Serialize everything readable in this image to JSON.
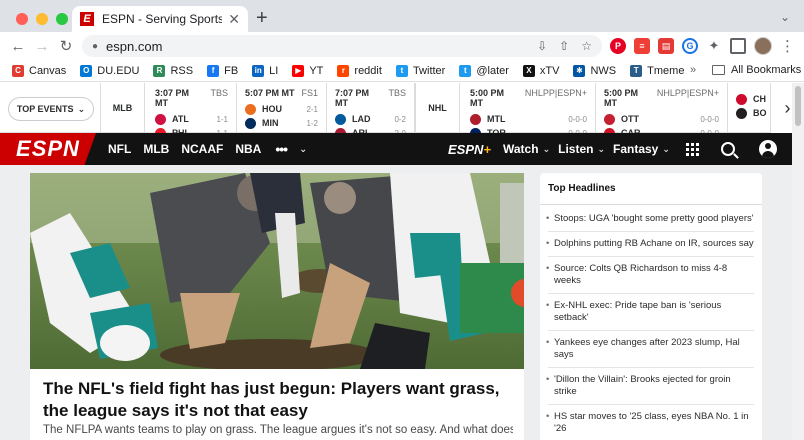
{
  "browser": {
    "tab_title": "ESPN - Serving Sports Fans. A",
    "tab_favicon": "E",
    "new_tab": "+",
    "url": "espn.com",
    "traffic_lights": [
      "#ff5f57",
      "#febc2e",
      "#28c840"
    ]
  },
  "bookmarks": {
    "items": [
      {
        "label": "Canvas",
        "color": "#e03c31",
        "glyph": "C"
      },
      {
        "label": "DU.EDU",
        "color": "#0078d4",
        "glyph": "O"
      },
      {
        "label": "RSS",
        "color": "#2e8b57",
        "glyph": "R"
      },
      {
        "label": "FB",
        "color": "#1877f2",
        "glyph": "f"
      },
      {
        "label": "LI",
        "color": "#0a66c2",
        "glyph": "in"
      },
      {
        "label": "YT",
        "color": "#ff0000",
        "glyph": "▶"
      },
      {
        "label": "reddit",
        "color": "#ff4500",
        "glyph": "r"
      },
      {
        "label": "Twitter",
        "color": "#1d9bf0",
        "glyph": "t"
      },
      {
        "label": "@later",
        "color": "#1d9bf0",
        "glyph": "t"
      },
      {
        "label": "xTV",
        "color": "#111111",
        "glyph": "X"
      },
      {
        "label": "NWS",
        "color": "#0057a8",
        "glyph": "✱"
      },
      {
        "label": "Tmeme",
        "color": "#2b5d8a",
        "glyph": "T"
      }
    ],
    "more": "»",
    "all_bookmarks": "All Bookmarks"
  },
  "scoreboard": {
    "top_events": "TOP EVENTS",
    "league_mlb": "MLB",
    "league_nhl": "NHL",
    "games": [
      {
        "time": "3:07 PM MT",
        "net": "TBS",
        "teams": [
          {
            "abbr": "ATL",
            "rec": "1-1",
            "color": "#ce1141"
          },
          {
            "abbr": "PHI",
            "rec": "1-1",
            "color": "#e81828"
          }
        ]
      },
      {
        "time": "5:07 PM MT",
        "net": "FS1",
        "teams": [
          {
            "abbr": "HOU",
            "rec": "2-1",
            "color": "#eb6e1f"
          },
          {
            "abbr": "MIN",
            "rec": "1-2",
            "color": "#002b5c"
          }
        ]
      },
      {
        "time": "7:07 PM MT",
        "net": "TBS",
        "teams": [
          {
            "abbr": "LAD",
            "rec": "0-2",
            "color": "#005a9c"
          },
          {
            "abbr": "ARI",
            "rec": "2-0",
            "color": "#a71930"
          }
        ]
      },
      {
        "time": "5:00 PM MT",
        "net": "NHLPP|ESPN+",
        "teams": [
          {
            "abbr": "MTL",
            "rec": "0-0-0",
            "color": "#af1e2d"
          },
          {
            "abbr": "TOR",
            "rec": "0-0-0",
            "color": "#00205b"
          }
        ]
      },
      {
        "time": "5:00 PM MT",
        "net": "NHLPP|ESPN+",
        "teams": [
          {
            "abbr": "OTT",
            "rec": "0-0-0",
            "color": "#c52032"
          },
          {
            "abbr": "CAR",
            "rec": "0-0-0",
            "color": "#ce1126"
          }
        ]
      },
      {
        "time": "",
        "net": "",
        "teams": [
          {
            "abbr": "CH",
            "rec": "",
            "color": "#cf0a2c"
          },
          {
            "abbr": "BO",
            "rec": "",
            "color": "#231f20"
          }
        ]
      }
    ]
  },
  "espn_nav": {
    "logo": "ESPN",
    "left": [
      "NFL",
      "MLB",
      "NCAAF",
      "NBA"
    ],
    "more": "•••",
    "espn_plus_text": "ESPN",
    "espn_plus_mark": "+",
    "right": [
      "Watch",
      "Listen",
      "Fantasy"
    ]
  },
  "hero": {
    "title": "The NFL's field fight has just begun: Players want grass, the league says it's not that easy",
    "subtitle": "The NFLPA wants teams to play on grass. The league argues it's not so easy. And what does the"
  },
  "headlines": {
    "title": "Top Headlines",
    "items": [
      "Stoops: UGA 'bought some pretty good players'",
      "Dolphins putting RB Achane on IR, sources say",
      "Source: Colts QB Richardson to miss 4-8 weeks",
      "Ex-NHL exec: Pride tape ban is 'serious setback'",
      "Yankees eye changes after 2023 slump, Hal says",
      "'Dillon the Villain': Brooks ejected for groin strike",
      "HS star moves to '25 class, eyes NBA No. 1 in '26"
    ]
  },
  "colors": {
    "espn_red": "#cc0000",
    "nav_bg": "#121213",
    "espn_plus_gold": "#ffb81c"
  }
}
